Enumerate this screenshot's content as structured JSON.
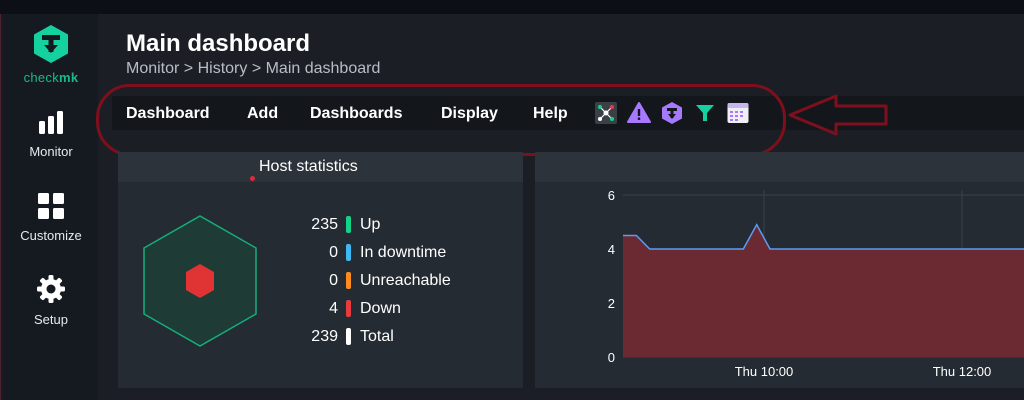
{
  "sidebar": {
    "logo_text_a": "check",
    "logo_text_b": "mk",
    "items": [
      {
        "label": "Monitor",
        "icon": "bar-chart-icon"
      },
      {
        "label": "Customize",
        "icon": "grid-icon"
      },
      {
        "label": "Setup",
        "icon": "gear-icon"
      }
    ]
  },
  "header": {
    "title": "Main dashboard",
    "breadcrumb": "Monitor > History > Main dashboard"
  },
  "menubar": {
    "items": [
      "Dashboard",
      "Add",
      "Dashboards",
      "Display",
      "Help"
    ],
    "icons": [
      "network-map-icon",
      "warning-icon",
      "checkmk-icon",
      "filter-icon",
      "calendar-icon"
    ]
  },
  "host_statistics": {
    "title": "Host statistics",
    "rows": [
      {
        "count": "235",
        "label": "Up",
        "color": "#13d389"
      },
      {
        "count": "0",
        "label": "In downtime",
        "color": "#3eb8f5"
      },
      {
        "count": "0",
        "label": "Unreachable",
        "color": "#ff8c1a"
      },
      {
        "count": "4",
        "label": "Down",
        "color": "#e83b3b"
      },
      {
        "count": "239",
        "label": "Total",
        "color": "#ffffff"
      }
    ]
  },
  "chart_data": {
    "type": "area",
    "title": "",
    "xlabel": "",
    "ylabel": "",
    "ylim": [
      0,
      6
    ],
    "yticks": [
      "0",
      "2",
      "4",
      "6"
    ],
    "xticks": [
      "Thu 10:00",
      "Thu 12:00"
    ],
    "series": [
      {
        "color": "#5a9cf8",
        "fill": "#6b2a31",
        "values": [
          4.5,
          4.5,
          4.0,
          4.0,
          4.0,
          4.0,
          4.0,
          4.0,
          4.0,
          4.0,
          4.9,
          4.0,
          4.0,
          4.0,
          4.0,
          4.0,
          4.0,
          4.0,
          4.0,
          4.0,
          4.0,
          4.0,
          4.0,
          4.0,
          4.0,
          4.0,
          4.0,
          4.0,
          4.0,
          4.0,
          4.0
        ]
      }
    ]
  },
  "colors": {
    "accent": "#15d1a0",
    "highlight_annotation": "#7e0f1c",
    "hexagon_stroke": "#14b07c",
    "down_red": "#e03434"
  }
}
